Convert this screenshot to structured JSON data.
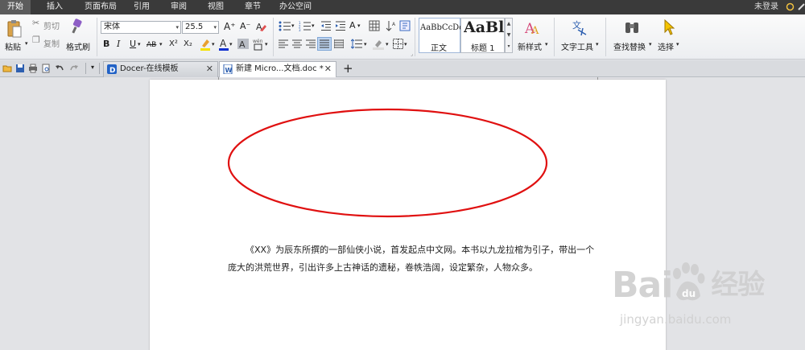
{
  "menubar": {
    "items": [
      "开始",
      "插入",
      "页面布局",
      "引用",
      "审阅",
      "视图",
      "章节",
      "办公空间"
    ],
    "login": "未登录"
  },
  "ribbon": {
    "paste": "粘贴",
    "cut": "剪切",
    "copy": "复制",
    "format_painter": "格式刷",
    "font_name": "宋体",
    "font_size": "25.5",
    "style_normal_preview": "AaBbCcDd",
    "style_normal": "正文",
    "style_heading_preview": "AaBl",
    "style_heading": "标题 1",
    "new_style": "新样式",
    "text_tools": "文字工具",
    "find_replace": "查找替换",
    "select": "选择",
    "bold": "B",
    "italic": "I",
    "underline": "U",
    "strike": "AB",
    "superscript": "X²",
    "subscript": "X₂"
  },
  "tabs": [
    {
      "title": "Docer-在线模板"
    },
    {
      "title": "新建 Micro...文档.doc *"
    }
  ],
  "document": {
    "paragraph": "《XX》为辰东所撰的一部仙侠小说，首发起点中文网。本书以九龙拉棺为引子，带出一个庞大的洪荒世界，引出许多上古神话的遗秘，卷帙浩阔，设定繁杂，人物众多。"
  },
  "watermark": {
    "brand": "Bai",
    "brand2": "du",
    "brand3": "经验",
    "url": "jingyan.baidu.com"
  },
  "colors": {
    "menubar_bg": "#3a3a3a",
    "ellipse_stroke": "#e01010",
    "page_bg": "#ffffff",
    "workspace_bg": "#e2e3e6"
  }
}
